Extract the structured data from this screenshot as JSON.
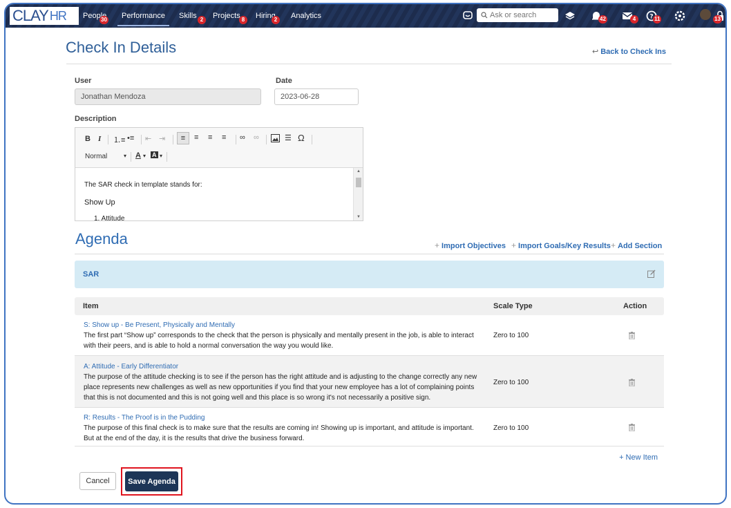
{
  "nav": {
    "logo_main": "CLAY",
    "logo_sub": "HR",
    "items": [
      {
        "label": "People",
        "badge": "30"
      },
      {
        "label": "Performance",
        "badge": ""
      },
      {
        "label": "Skills",
        "badge": "2"
      },
      {
        "label": "Projects",
        "badge": "8"
      },
      {
        "label": "Hiring",
        "badge": "2"
      },
      {
        "label": "Analytics",
        "badge": ""
      }
    ],
    "search_placeholder": "Ask or search",
    "badges": {
      "notifications": "42",
      "messages": "4",
      "help": "11",
      "lock": "13"
    }
  },
  "page": {
    "title": "Check In Details",
    "back_link": "Back to Check Ins"
  },
  "form": {
    "user_label": "User",
    "user_value": "Jonathan Mendoza",
    "date_label": "Date",
    "date_value": "2023-06-28",
    "description_label": "Description",
    "editor": {
      "format_select": "Normal",
      "lines": [
        "The SAR check in template stands for:",
        "Show Up",
        "1. Attitude"
      ]
    }
  },
  "agenda": {
    "title": "Agenda",
    "import_objectives": "Import Objectives",
    "import_goals": "Import Goals/Key Results",
    "add_section": "Add Section",
    "section_name": "SAR",
    "columns": {
      "item": "Item",
      "scale_type": "Scale Type",
      "action": "Action"
    },
    "items": [
      {
        "title": "S: Show up - Be Present, Physically and Mentally",
        "description": "The first part “Show up” corresponds to the check that the person is physically and mentally present in the job, is able to interact with their peers, and is able to hold a normal conversation the way you would like.",
        "scale": "Zero to 100"
      },
      {
        "title": "A: Attitude - Early Differentiator",
        "description": "The purpose of the attitude checking is to see if the person has the right attitude and is adjusting to the change correctly any new place represents new challenges as well as new opportunities if you find that your new employee has a lot of complaining points that this is not documented and this is not going well and this place is so wrong  it's not necessarily a positive sign.",
        "scale": "Zero to 100"
      },
      {
        "title": "R: Results - The Proof is in the Pudding",
        "description": "The purpose of this final check is to make sure that the results are coming in!  Showing up is important, and attitude is important.  But at the end of the day, it is the results that drive the business forward.",
        "scale": "Zero to 100"
      }
    ],
    "new_item": "+ New Item"
  },
  "buttons": {
    "cancel": "Cancel",
    "save": "Save Agenda"
  },
  "colors": {
    "nav_bg": "#1d2c4d",
    "link": "#2f6cb3",
    "save_bg": "#1d3557",
    "highlight": "#e0141e",
    "section_bg": "#d5ebf5"
  }
}
